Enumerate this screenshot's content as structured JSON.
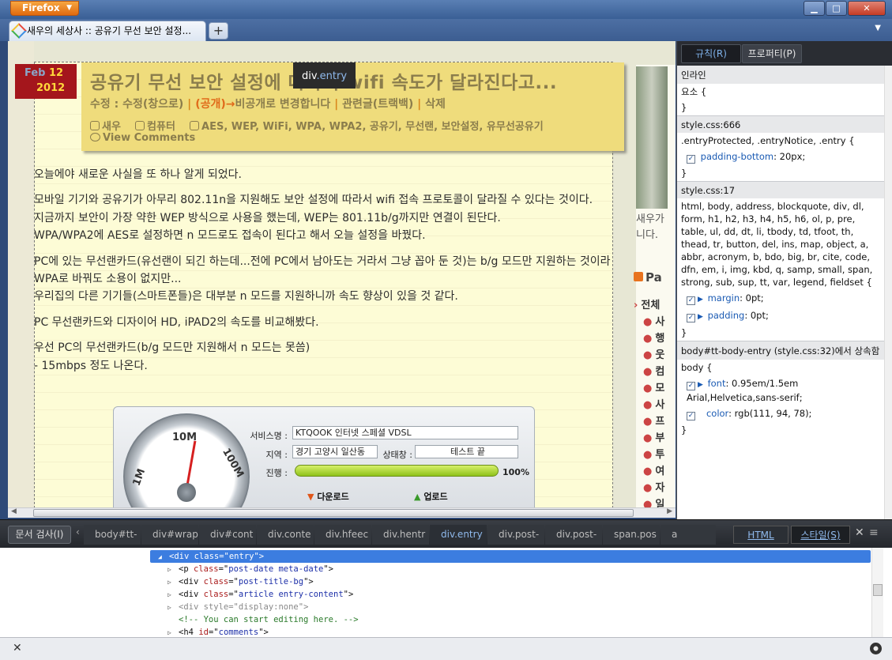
{
  "window": {
    "app_button": "Firefox",
    "controls": {
      "minimize": "▁",
      "maximize": "□",
      "close": "✕"
    }
  },
  "tabs": [
    {
      "title": "새우의 세상사 :: 공유기 무선 보안 설정..."
    }
  ],
  "new_tab": "+",
  "post": {
    "date_month": "Feb",
    "date_day": "12",
    "date_year": "2012",
    "title": "공유기 무선 보안 설정에 따라서 wifi 속도가 달라진다고...",
    "inspect_tooltip": {
      "tag": "div",
      "cls": ".entry"
    },
    "edit_links": {
      "prefix": "수정 : ",
      "edit": "수정(창으로)",
      "publish": "(공개)→",
      "publish_tail": "비공개로 변경합니다",
      "trackback": "관련글(트랙백)",
      "delete": "삭제",
      "sep": " | "
    },
    "author": "새우",
    "category": "컴퓨터",
    "tags": "AES, WEP, WiFi, WPA, WPA2, 공유기, 무선랜, 보안설정, 유무선공유기",
    "view_comments": "View Comments",
    "paragraphs": [
      "오늘에야 새로운 사실을 또 하나 알게 되었다.",
      "모바일 기기와 공유기가 아무리 802.11n을 지원해도 보안 설정에 따라서 wifi 접속 프로토콜이 달라질 수 있다는 것이다.\n지금까지 보안이 가장 약한 WEP 방식으로 사용을 했는데, WEP는 801.11b/g까지만 연결이 된단다.\nWPA/WPA2에 AES로 설정하면 n 모드로도 접속이 된다고 해서 오늘 설정을 바꿨다.",
      "PC에 있는 무선랜카드(유선랜이 되긴 하는데...전에 PC에서 남아도는 거라서 그냥 꼽아 둔 것)는 b/g 모드만 지원하는 것이라 WPA로 바꿔도 소용이 없지만...\n우리집의 다른 기기들(스마트폰들)은 대부분 n 모드를 지원하니까 속도 향상이 있을 것 같다.",
      "PC 무선랜카드와 디자이어 HD, iPAD2의 속도를 비교해봤다.",
      "우선 PC의 무선랜카드(b/g 모드만 지원해서 n 모드는 못씀)\n - 15mbps 정도 나온다."
    ],
    "screenshot": {
      "service_label": "서비스명 :",
      "service_value": "KTQOOK 인터넷 스페셜 VDSL",
      "region_label": "지역 :",
      "region_value": "경기 고양시 일산동",
      "status_label": "상태창 :",
      "status_value": "테스트 끝",
      "progress_label": "진행 :",
      "progress_pct": "100%",
      "progress_fraction": 1.0,
      "download_label": "다운로드",
      "upload_label": "업로드",
      "gauge_labels": [
        "1M",
        "10M",
        "100M"
      ]
    }
  },
  "sidebar": {
    "text": "새우가\n니다.",
    "rss_title": "Pa",
    "categories": [
      "전체",
      "사",
      "행",
      "웃",
      "컴",
      "모",
      "사",
      "프",
      "부",
      "투",
      "여",
      "자",
      "일"
    ]
  },
  "styles_panel": {
    "tab_rules": "규칙(R)",
    "tab_props": "프로퍼티(P)",
    "inline_header": "인라인",
    "inline_rule_open": "요소 {",
    "close_brace": "}",
    "rule1_source": "style.css:666",
    "rule1_selector": ".entryProtected, .entryNotice, .entry {",
    "rule1_decls": [
      {
        "prop": "padding-bottom",
        "val": ": 20px;"
      }
    ],
    "rule2_source": "style.css:17",
    "rule2_selector": "html, body, address, blockquote, div, dl, form, h1, h2, h3, h4, h5, h6, ol, p, pre, table, ul, dd, dt, li, tbody, td, tfoot, th, thead, tr, button, del, ins, map, object, a, abbr, acronym, b, bdo, big, br, cite, code, dfn, em, i, img, kbd, q, samp, small, span, strong, sub, sup, tt, var, legend, fieldset {",
    "rule2_decls": [
      {
        "prop": "margin",
        "val": ": 0pt;"
      },
      {
        "prop": "padding",
        "val": ": 0pt;"
      }
    ],
    "inherited_header": "body#tt-body-entry (style.css:32)에서 상속함",
    "rule3_selector": "body {",
    "rule3_decls": [
      {
        "prop": "font",
        "val": ": 0.95em/1.5em Arial,Helvetica,sans-serif;"
      },
      {
        "prop": "color",
        "val": ": rgb(111, 94, 78);"
      }
    ]
  },
  "devtools": {
    "inspect_button": "문서 검사(I)",
    "crumbs_left_arrow": "‹",
    "breadcrumbs": [
      "body#tt-",
      "div#wrap",
      "div#cont",
      "div.conte",
      "div.hfeec",
      "div.hentr",
      "div.entry",
      "div.post-",
      "div.post-",
      "span.pos",
      "a"
    ],
    "selected_crumb": 6,
    "html_button": "HTML",
    "style_button": "스타일(S)",
    "close": "✕",
    "menu": "≡",
    "markup": [
      {
        "indent": 0,
        "twisty": "◢",
        "text": "<div class=\"entry\">",
        "selected": true
      },
      {
        "indent": 1,
        "twisty": "▷",
        "tag": "p",
        "attr": "class",
        "value": "post-date meta-date"
      },
      {
        "indent": 1,
        "twisty": "▷",
        "tag": "div",
        "attr": "class",
        "value": "post-title-bg"
      },
      {
        "indent": 1,
        "twisty": "▷",
        "tag": "div",
        "attr": "class",
        "value": "article entry-content"
      },
      {
        "indent": 1,
        "twisty": "▷",
        "tag": "div",
        "attr": "style",
        "value": "display:none",
        "dim": true
      },
      {
        "indent": 1,
        "twisty": "",
        "comment": "<!-- You can start editing here. -->"
      },
      {
        "indent": 1,
        "twisty": "▷",
        "tag": "h4",
        "attr": "id",
        "value": "comments"
      }
    ]
  },
  "statusbar": {
    "close": "✕"
  }
}
